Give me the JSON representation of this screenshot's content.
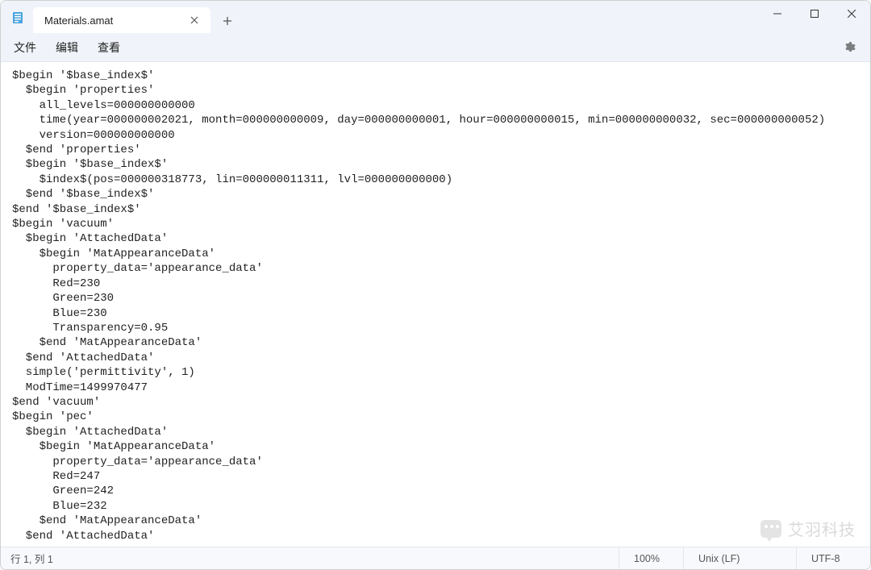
{
  "tab": {
    "title": "Materials.amat"
  },
  "menu": {
    "file": "文件",
    "edit": "编辑",
    "view": "查看"
  },
  "editor": {
    "lines": [
      "$begin '$base_index$'",
      "  $begin 'properties'",
      "    all_levels=000000000000",
      "    time(year=000000002021, month=000000000009, day=000000000001, hour=000000000015, min=000000000032, sec=000000000052)",
      "    version=000000000000",
      "  $end 'properties'",
      "  $begin '$base_index$'",
      "    $index$(pos=000000318773, lin=000000011311, lvl=000000000000)",
      "  $end '$base_index$'",
      "$end '$base_index$'",
      "$begin 'vacuum'",
      "  $begin 'AttachedData'",
      "    $begin 'MatAppearanceData'",
      "      property_data='appearance_data'",
      "      Red=230",
      "      Green=230",
      "      Blue=230",
      "      Transparency=0.95",
      "    $end 'MatAppearanceData'",
      "  $end 'AttachedData'",
      "  simple('permittivity', 1)",
      "  ModTime=1499970477",
      "$end 'vacuum'",
      "$begin 'pec'",
      "  $begin 'AttachedData'",
      "    $begin 'MatAppearanceData'",
      "      property_data='appearance_data'",
      "      Red=247",
      "      Green=242",
      "      Blue=232",
      "    $end 'MatAppearanceData'",
      "  $end 'AttachedData'"
    ]
  },
  "status": {
    "position": "行 1, 列 1",
    "zoom": "100%",
    "lineEnding": "Unix (LF)",
    "encoding": "UTF-8"
  },
  "watermark": {
    "text": "艾羽科技"
  }
}
